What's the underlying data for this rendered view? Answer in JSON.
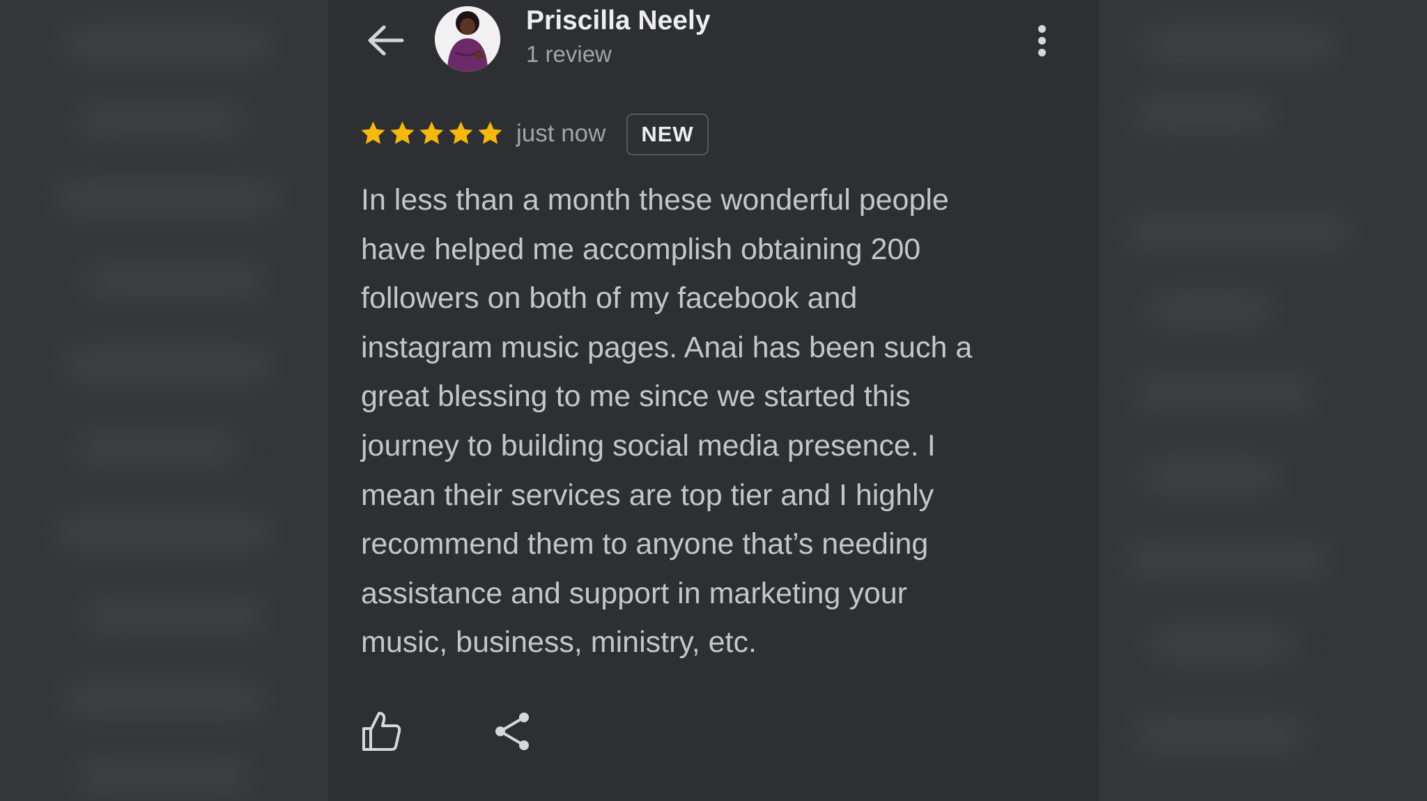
{
  "header": {
    "author_name": "Priscilla Neely",
    "review_count": "1 review",
    "back_icon": "arrow-left-icon",
    "more_icon": "more-vertical-icon"
  },
  "review": {
    "rating": 5,
    "rating_max": 5,
    "timestamp": "just now",
    "badge": "NEW",
    "text_lines": [
      "In less than a month these wonderful people",
      "have helped me accomplish obtaining 200",
      "followers on both of my facebook and",
      "instagram music pages. Anai has been such a",
      "great blessing to me since we started this",
      "journey to building social media presence. I",
      "mean their services are top tier and I highly",
      "recommend them to anyone that’s needing",
      "assistance and support in marketing your",
      "music, business, ministry, etc."
    ]
  },
  "actions": {
    "like_icon": "thumbs-up-icon",
    "share_icon": "share-icon"
  },
  "colors": {
    "background": "#2e2f33",
    "star": "#f6b80c",
    "primary_text": "#eeeef0",
    "secondary_text": "#a3a4a8",
    "body_text": "#c5c6c9",
    "badge_border": "#57585c",
    "avatar_dress": "#6b2a68"
  }
}
